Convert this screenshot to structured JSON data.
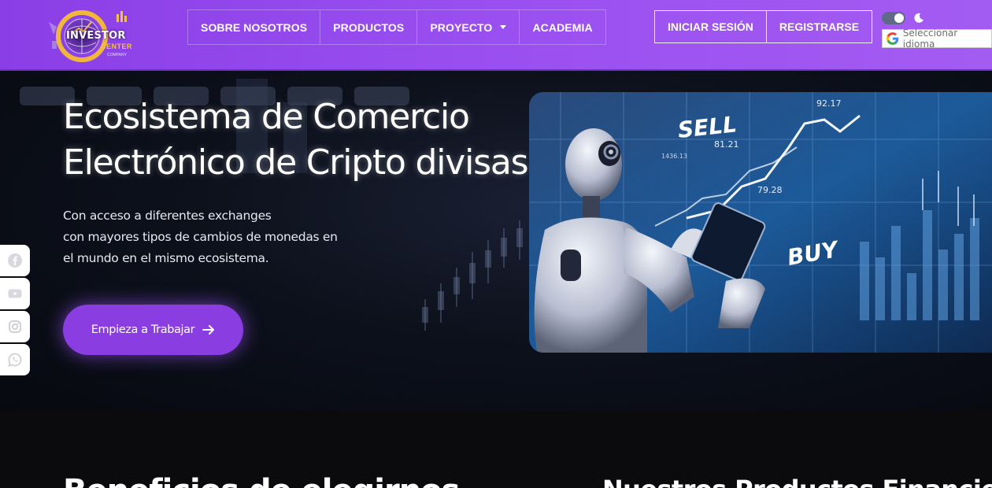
{
  "brand": {
    "logo_text": "INVESTOR",
    "logo_sub": "CENTER",
    "logo_tiny": "COMPANY"
  },
  "nav": {
    "items": [
      {
        "label": "SOBRE NOSOTROS"
      },
      {
        "label": "PRODUCTOS"
      },
      {
        "label": "PROYECTO"
      },
      {
        "label": "ACADEMIA"
      }
    ]
  },
  "auth": {
    "login_label": "INICIAR SESIÓN",
    "register_label": "REGISTRARSE"
  },
  "theme": {
    "mode": "dark"
  },
  "language": {
    "placeholder": "Seleccionar idioma"
  },
  "hero": {
    "title_line1": "Ecosistema de Comercio",
    "title_line2": "Electrónico de Cripto divisas",
    "desc_line1": "Con acceso a diferentes exchanges",
    "desc_line2": "con mayores tipos de cambios de monedas en",
    "desc_line3": "el mundo en el mismo ecosistema.",
    "cta_label": "Empieza a Trabajar",
    "image_labels": {
      "sell": "SELL",
      "buy": "BUY",
      "v1": "92.17",
      "v2": "81.21",
      "v3": "79.28",
      "v4": "1436.13"
    }
  },
  "social": {
    "items": [
      {
        "icon": "facebook-icon"
      },
      {
        "icon": "youtube-icon"
      },
      {
        "icon": "instagram-icon"
      },
      {
        "icon": "whatsapp-icon"
      }
    ]
  },
  "section2": {
    "title_left": "Beneficios de elegirnos",
    "title_right": "Nuestros Productos Financieros"
  },
  "colors": {
    "header_purple": "#9a4ff0",
    "cta_purple": "#8a3de0",
    "logo_gold": "#f3c04a"
  }
}
